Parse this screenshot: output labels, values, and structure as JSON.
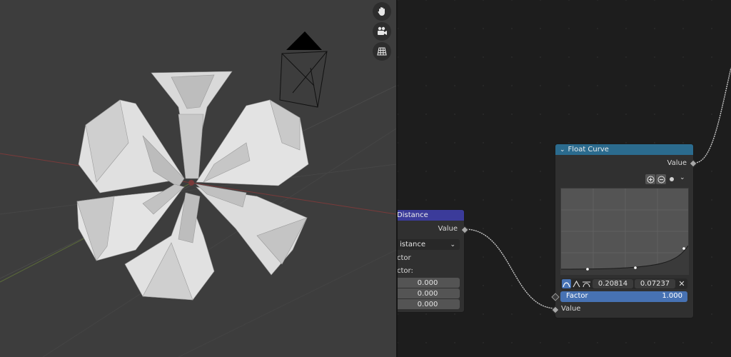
{
  "viewport": {
    "nav_icons": [
      "hand-pan-icon",
      "camera-icon",
      "grid-icon"
    ]
  },
  "distance_node": {
    "title": "Distance",
    "output_label": "Value",
    "dropdown_value": "istance",
    "row1_label": "ctor",
    "row2_label": "ctor:",
    "vector_values": [
      "0.000",
      "0.000",
      "0.000"
    ]
  },
  "float_curve_node": {
    "title": "Float Curve",
    "output_label": "Value",
    "curve_x": "0.20814",
    "curve_y": "0.07237",
    "factor_label": "Factor",
    "factor_value": "1.000",
    "input_label": "Value"
  },
  "colors": {
    "distance_header": "#3b3b9a",
    "float_curve_header": "#2b6b8e",
    "factor_bar": "#4772b3"
  }
}
